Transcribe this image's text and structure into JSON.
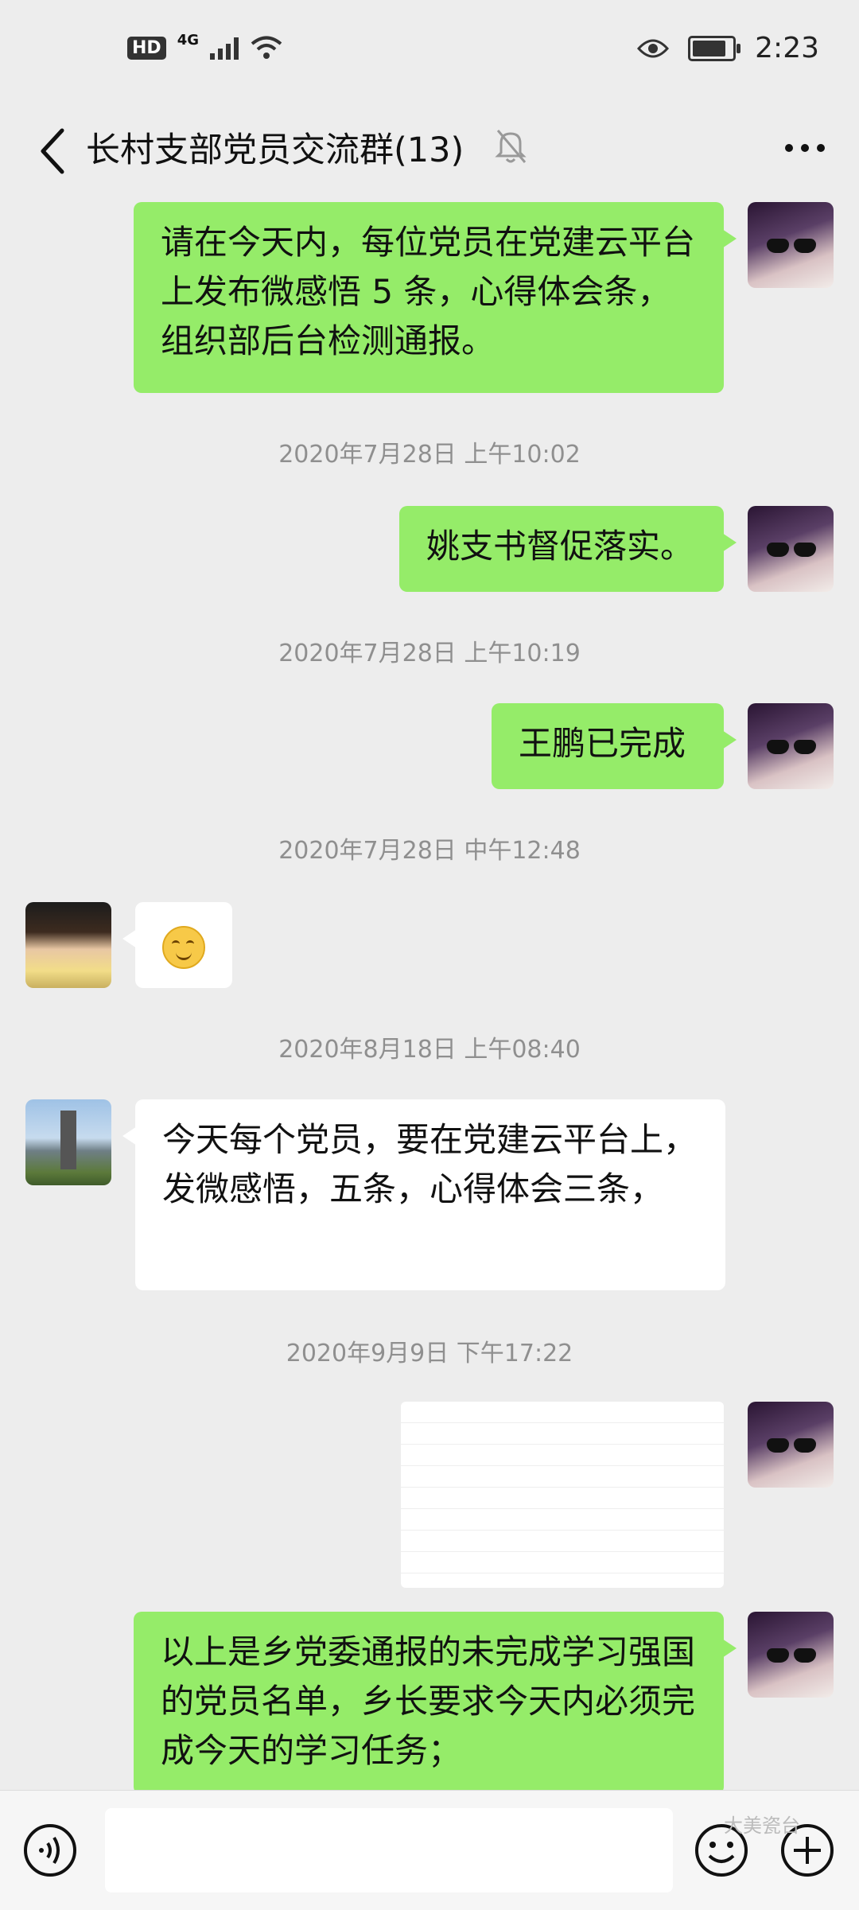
{
  "status_bar": {
    "hd": "HD",
    "network": "4G",
    "time": "2:23",
    "battery_level": 0.85
  },
  "header": {
    "title": "长村支部党员交流群(13)"
  },
  "messages": [
    {
      "side": "right",
      "text": "请在今天内，每位党员在党建云平台上发布微感悟 5 条，心得体会条，组织部后台检测通报。"
    },
    {
      "timestamp": "2020年7月28日 上午10:02"
    },
    {
      "side": "right",
      "text": "姚支书督促落实。"
    },
    {
      "timestamp": "2020年7月28日 上午10:19"
    },
    {
      "side": "right",
      "text": "王鹏已完成"
    },
    {
      "timestamp": "2020年7月28日 中午12:48"
    },
    {
      "side": "left",
      "type": "emoji"
    },
    {
      "timestamp": "2020年8月18日 上午08:40"
    },
    {
      "side": "left",
      "text": "今天每个党员，要在党建云平台上，发微感悟，五条，心得体会三条，"
    },
    {
      "timestamp": "2020年9月9日 下午17:22"
    },
    {
      "side": "right",
      "type": "image"
    },
    {
      "side": "right",
      "text": "以上是乡党委通报的未完成学习强国的党员名单，乡长要求今天内必须完成今天的学习任务；"
    }
  ],
  "watermark": "大美瓷台"
}
